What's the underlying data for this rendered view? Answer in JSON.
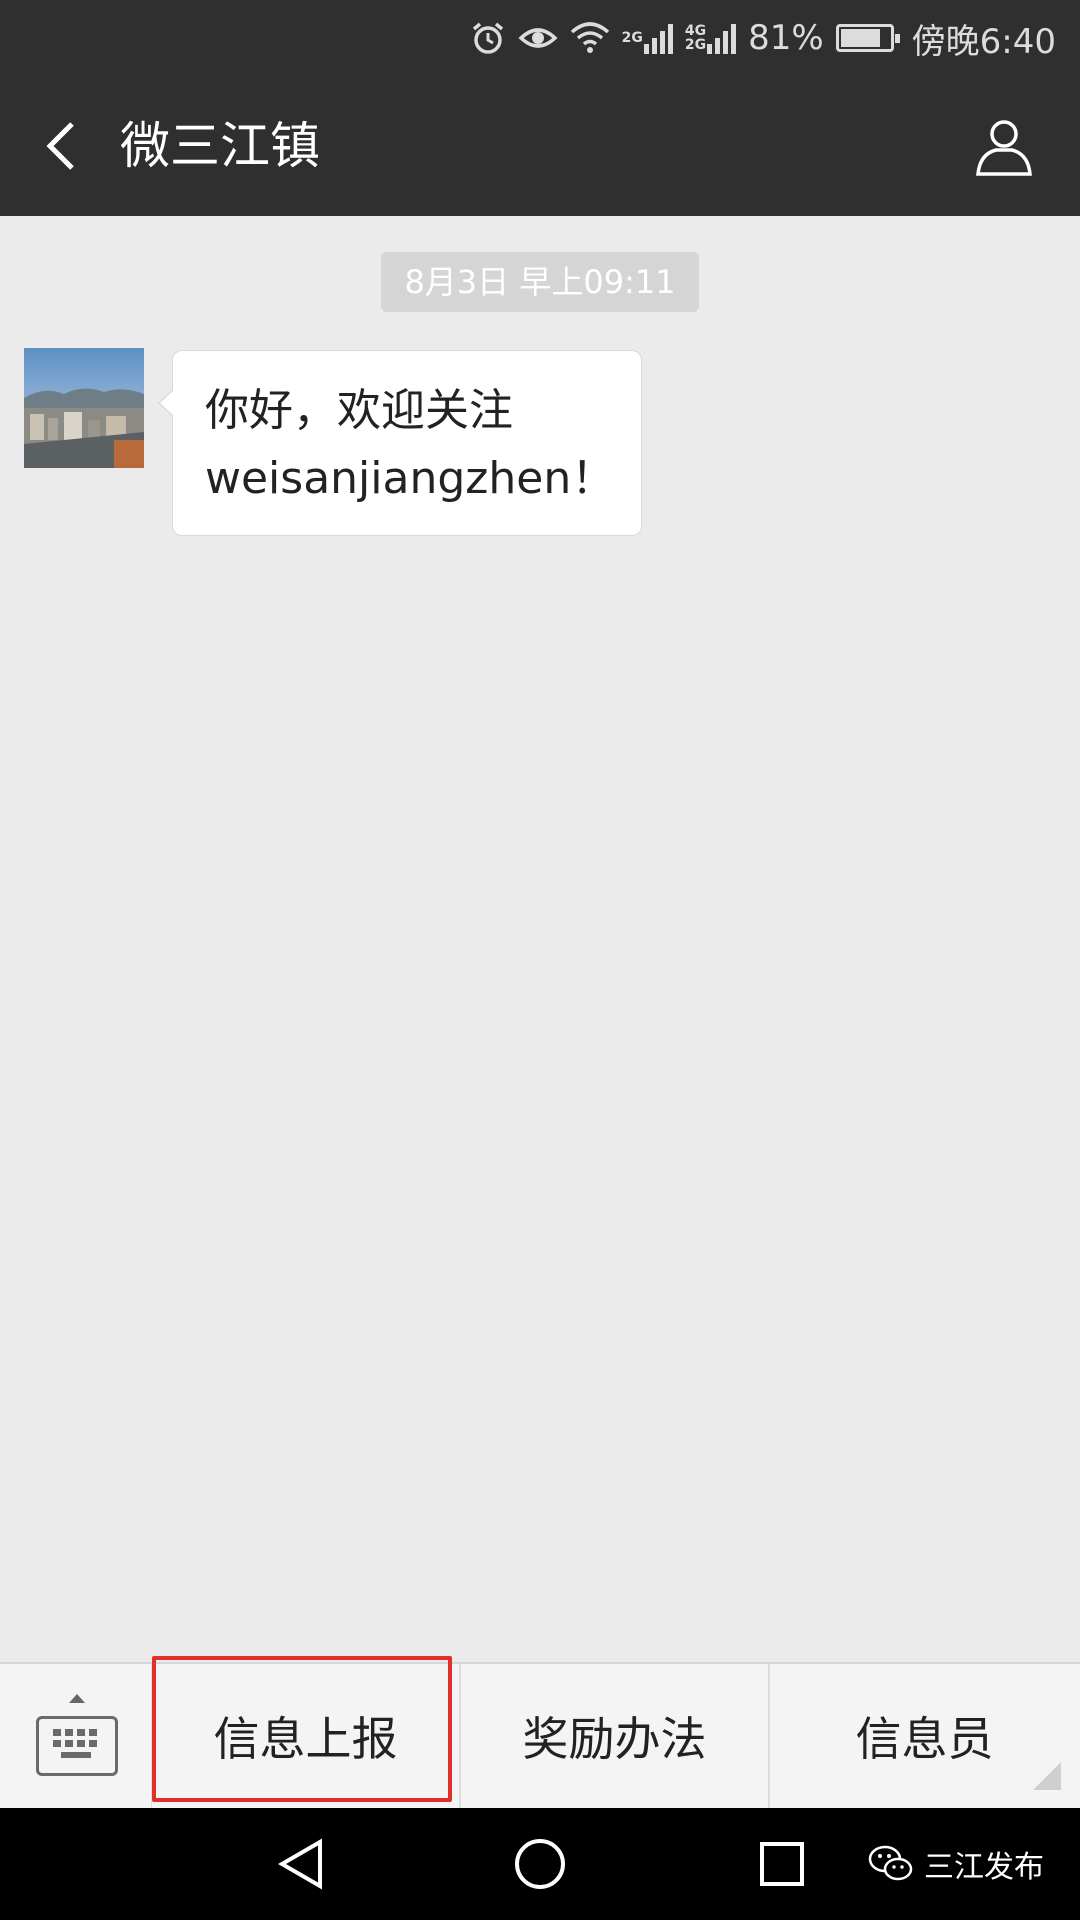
{
  "status_bar": {
    "battery_percent": "81%",
    "battery_level": 0.81,
    "time": "傍晚6:40",
    "net_top": "2G",
    "net_mid": "4G",
    "net_bot": "2G",
    "icons": [
      "alarm-icon",
      "eye-icon",
      "wifi-icon",
      "signal-2g-icon",
      "signal-4g-icon",
      "battery-icon"
    ]
  },
  "header": {
    "title": "微三江镇",
    "back_icon": "back-arrow-icon",
    "profile_icon": "person-icon"
  },
  "chat": {
    "timestamp": "8月3日 早上09:11",
    "messages": [
      {
        "sender_avatar": "town-scenery-photo",
        "line1": "你好，欢迎关注",
        "line2": "weisanjiangzhen！"
      }
    ]
  },
  "menu": {
    "items": [
      {
        "label": "信息上报"
      },
      {
        "label": "奖励办法"
      },
      {
        "label": "信息员"
      }
    ],
    "highlight_color": "#e0302a"
  },
  "watermark": {
    "text": "三江发布",
    "icon": "wechat-icon"
  }
}
